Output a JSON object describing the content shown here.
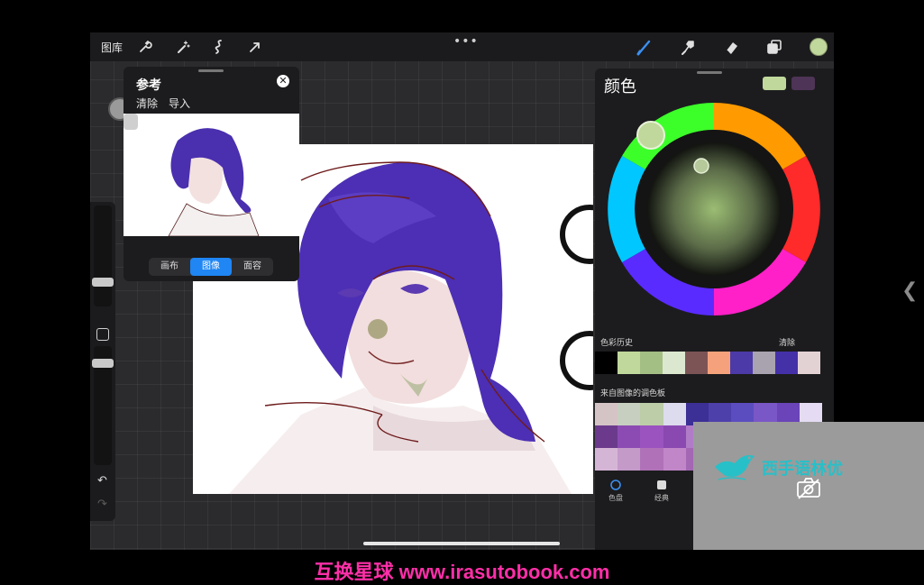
{
  "toolbar": {
    "gallery_label": "图库",
    "icons": [
      "wrench-icon",
      "magic-wand-icon",
      "selection-icon",
      "transform-arrow-icon",
      "brush-icon",
      "smudge-icon",
      "eraser-icon",
      "layers-icon"
    ],
    "more": "•••",
    "current_color": "#c0d89c"
  },
  "reference_panel": {
    "title": "参考",
    "clear_label": "清除",
    "import_label": "导入",
    "close": "✕",
    "tabs": [
      {
        "label": "画布",
        "active": false
      },
      {
        "label": "图像",
        "active": true
      },
      {
        "label": "面容",
        "active": false
      }
    ]
  },
  "color_panel": {
    "title": "颜色",
    "primary_swatch": "#c0d89c",
    "secondary_swatch": "#4e3456",
    "history_label": "色彩历史",
    "history_clear": "清除",
    "history_colors": [
      "#000000",
      "#c0d89c",
      "#a3bf84",
      "#dbe8cf",
      "#7d5456",
      "#f5a27c",
      "#4c3aa8",
      "#a8a3ae",
      "#4431a8",
      "#e3d2d4"
    ],
    "palette_label": "来自图像的调色板",
    "palette_colors": [
      "#d4c4c6",
      "#c7cfc0",
      "#bccda7",
      "#dcdcee",
      "#3c2f96",
      "#4e40ab",
      "#5b4dc0",
      "#7a57c7",
      "#6a44b8",
      "#e5dcf3",
      "#6b3a8c",
      "#8c4bb3",
      "#9b53c0",
      "#8a49b1",
      "#b07cc8",
      "#c9a4db",
      "#7348a8",
      "#6141a0",
      "#814fb6",
      "#9560c1",
      "#d5b5d6",
      "#c49ac9",
      "#b071b8",
      "#c186c8",
      "#a367b3",
      "#d09bd3",
      "#e6c8e5",
      "#b585c4",
      "#9f73b9",
      "#cfa9d6"
    ],
    "tabs": [
      {
        "label": "色盘",
        "icon": "disc-icon"
      },
      {
        "label": "经典",
        "icon": "square-icon"
      }
    ]
  },
  "watermark": {
    "text": "西手语林优"
  },
  "footer": {
    "text": "互换星球 www.irasutobook.com"
  }
}
